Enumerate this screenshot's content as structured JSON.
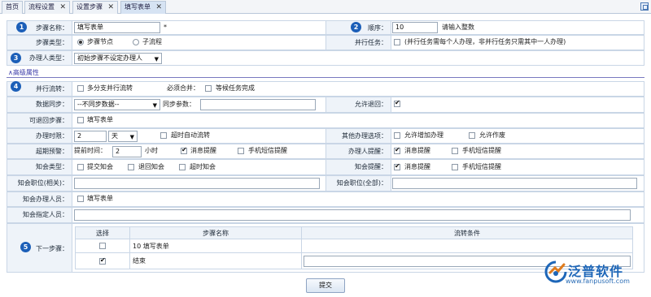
{
  "tabs": [
    {
      "label": "首页",
      "closable": false,
      "active": false
    },
    {
      "label": "流程设置",
      "closable": true,
      "active": false
    },
    {
      "label": "设置步骤",
      "closable": true,
      "active": false
    },
    {
      "label": "填写表单",
      "closable": true,
      "active": true
    }
  ],
  "badges": [
    "1",
    "2",
    "3",
    "4",
    "5"
  ],
  "form": {
    "step_name_label": "步骤名称：",
    "step_name_value": "填写表单",
    "required_mark": "*",
    "order_label": "顺序：",
    "order_value": "10",
    "order_hint": "请输入整数",
    "step_type_label": "步骤类型：",
    "step_type_options": [
      "步骤节点",
      "子流程"
    ],
    "step_type_selected": "步骤节点",
    "parallel_task_label": "并行任务：",
    "parallel_task_text": "(并行任务需每个人办理，非并行任务只需其中一人办理)",
    "handler_type_label": "办理人类型：",
    "handler_type_value": "初始步骤不设定办理人",
    "advanced_label": "高级属性",
    "parallel_flow_label": "并行流转：",
    "multi_branch_text": "多分支并行流转",
    "must_merge_label": "必须合并：",
    "wait_complete_text": "等候任务完成",
    "data_sync_label": "数据同步：",
    "data_sync_value": "--不同步数据--",
    "sync_param_label": "同步参数：",
    "sync_param_value": "",
    "allow_return_label": "允许退回：",
    "allow_return_checked": true,
    "returnable_label": "可退回步骤：",
    "returnable_text": "填写表单",
    "time_limit_label": "办理时限：",
    "time_limit_value": "2",
    "time_unit_value": "天",
    "timeout_auto_text": "超时自动流转",
    "other_options_label": "其他办理选项：",
    "allow_add_handler_text": "允许增加办理",
    "allow_void_text": "允许作废",
    "overtime_alert_label": "超期预警：",
    "advance_time_label": "提前时间：",
    "advance_time_value": "2",
    "hour_text": "小时",
    "msg_remind_text": "消息提醒",
    "sms_remind_text": "手机短信提醒",
    "handler_remind_label": "办理人提醒：",
    "notify_type_label": "知会类型：",
    "submit_notify_text": "提交知会",
    "return_notify_text": "退回知会",
    "overtime_notify_text": "超时知会",
    "notify_remind_label": "知会提醒：",
    "notify_post_rel_label": "知会职位(相关)：",
    "notify_post_rel_value": "",
    "notify_post_all_label": "知会职位(全部)：",
    "notify_post_all_value": "",
    "notify_handler_label": "知会办理人员：",
    "notify_handler_text": "填写表单",
    "notify_person_label": "知会指定人员：",
    "notify_person_value": "",
    "next_step_label": "下一步骤："
  },
  "next_steps": {
    "headers": [
      "选择",
      "步骤名称",
      "流转条件"
    ],
    "rows": [
      {
        "checked": false,
        "name": "10 填写表单",
        "condition": ""
      },
      {
        "checked": true,
        "name": "结束",
        "condition": ""
      }
    ]
  },
  "submit_label": "提交",
  "watermark": {
    "brand": "泛普软件",
    "url": "www.fanpusoft.com"
  },
  "colors": {
    "accent": "#1c5fb8",
    "label_bg": "#eef3f9",
    "border": "#c9d6e6"
  }
}
